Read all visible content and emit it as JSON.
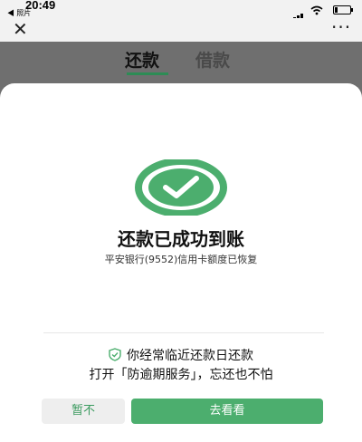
{
  "status_bar": {
    "time": "20:49",
    "back_app": "◀ 照片"
  },
  "nav": {
    "close": "✕",
    "more": "···"
  },
  "tabs": [
    {
      "label": "还款",
      "active": true
    },
    {
      "label": "借款",
      "active": false
    }
  ],
  "success": {
    "title": "还款已成功到账",
    "subtitle": "平安银行(9552)信用卡额度已恢复"
  },
  "promo": {
    "line1": "你经常临近还款日还款",
    "line2": "打开「防逾期服务」，忘还也不怕"
  },
  "buttons": {
    "dismiss": "暂不",
    "view": "去看看"
  },
  "colors": {
    "accent": "#4cae6e",
    "tab_underline": "#2d8c55",
    "overlay": "#6f6f6f"
  },
  "icons": [
    "signal-icon",
    "wifi-icon",
    "battery-icon",
    "close-icon",
    "more-icon",
    "check-circle-icon",
    "shield-check-icon"
  ]
}
